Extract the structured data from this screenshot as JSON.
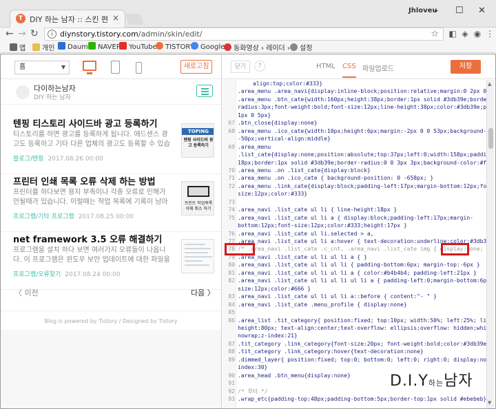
{
  "browser": {
    "tab_title": "DIY 하는 남자 :: 스킨 편",
    "tab_close": "×",
    "user": "Jhloveu",
    "win_min": "–",
    "win_max": "☐",
    "win_close": "✕",
    "url_host": "diynstory.tistory.com",
    "url_path": "/admin/skin/edit/",
    "bookmarks": [
      "앱",
      "개인",
      "Daum",
      "NAVER",
      "YouTube",
      "TISTORY",
      "Google",
      "동화영상 › 레이더 ›",
      "설정"
    ]
  },
  "preview": {
    "select_value": "홈",
    "refresh_label": "새로고침",
    "blog_title": "다이하는남자",
    "blog_sub": "DIY 하는 남자",
    "posts": [
      {
        "title": "텐핑 티스토리 사이드바 광고 등록하기",
        "excerpt": "티스토리를 하면 광고를 등록하게 됩니다. 애드센스 광고도 등록하고 기타 다른 업체의 광고도 등록할 수 있습니...",
        "category": "블로그/텐핑",
        "date": "2017.08.26 00:00",
        "thumb_top": "TOPING",
        "thumb_text": "텐핑 사이드바 광고 등록하기"
      },
      {
        "title": "프린터 인쇄 목록 오류 삭제 하는 방법",
        "excerpt": "프린터를 하다보면 용지 부족이나 각종 오류로 인해가 안될때가 있습니다. 이럴때는 작업 목록에 기록이 남아있어...",
        "category": "프로그램/기타 프로그램",
        "date": "2017.08.25 00:00",
        "thumb_text": "프린트 작업목록 삭제 취소 하기"
      },
      {
        "title": "net framework 3.5 오류 해결하기",
        "excerpt": "프로그램을 설치 하다 보면 여러가지 오류들이 나옵니다. 이 프로그램은 윈도우 보안 업데이트에 대한 파일을 입...",
        "category": "프로그램/오류찾기",
        "date": "2017.08.24 00:00"
      }
    ],
    "prev_label": "〈 이전",
    "next_label": "다음 〉",
    "powered": "Blog is powered by Tistory / Designed by Tistory"
  },
  "code_editor": {
    "cancel_label": "닫기",
    "help_label": "?",
    "tabs": [
      "HTML",
      "CSS",
      "파일업로드"
    ],
    "active_tab": "CSS",
    "save_label": "저장",
    "lines": [
      {
        "n": "",
        "t": "align:top;color:#333}",
        "cls": "wrap"
      },
      {
        "n": "",
        "t": ".area_menu .area_navi{display:inline-block;position:relative;margin:0 2px 0 3px}",
        "cls": ""
      },
      {
        "n": "",
        "t": ".area_menu .btn_cate{width:160px;height:38px;border:1px solid #3db39e;border-",
        "cls": ""
      },
      {
        "n": "",
        "t": "radius:3px;font-weight:bold;font-size:12px;line-height:38px;color:#3db39e;padding:0",
        "cls": ""
      },
      {
        "n": "",
        "t": "1px 0 5px}",
        "cls": ""
      },
      {
        "n": "67",
        "t": ".btn_close{display:none}",
        "cls": ""
      },
      {
        "n": "68",
        "t": ".area_menu .ico_cate{width:10px;height:6px;margin:-2px 0 0 53px;background-position:0",
        "cls": ""
      },
      {
        "n": "",
        "t": "-50px;vertical-align:middle}",
        "cls": ""
      },
      {
        "n": "69",
        "t": ".area_menu",
        "cls": ""
      },
      {
        "n": "",
        "t": ".list_cate{display:none;position:absolute;top:37px;left:0;width:158px;padding:18px 0",
        "cls": ""
      },
      {
        "n": "",
        "t": "18px;border:1px solid #3db39e;border-radius:0 0 3px 3px;background-color:#fff}",
        "cls": ""
      },
      {
        "n": "70",
        "t": ".area_menu .on .list_cate{display:block}",
        "cls": ""
      },
      {
        "n": "71",
        "t": ".area_menu .on .ico_cate { background-position: 0 -658px; }",
        "cls": ""
      },
      {
        "n": "72",
        "t": ".area_menu .link_cate{display:block;padding-left:17px;margin-bottom:12px;font-",
        "cls": ""
      },
      {
        "n": "",
        "t": "size:12px;color:#333}",
        "cls": ""
      },
      {
        "n": "73",
        "t": "",
        "cls": ""
      },
      {
        "n": "74",
        "t": ".area_navi .list_cate ul li { line-height:18px }",
        "cls": ""
      },
      {
        "n": "75",
        "t": ".area_navi .list_cate ul li a { display:block;padding-left:17px;margin-",
        "cls": ""
      },
      {
        "n": "",
        "t": "bottom:12px;font-size:12px;color:#333;height:17px }",
        "cls": ""
      },
      {
        "n": "76",
        "t": ".area_navi .list_cate ul li.selected > a,",
        "cls": ""
      },
      {
        "n": "77",
        "t": ".area_navi .list_cate ul li a:hover { text-decoration:underline;color:#3db39e }",
        "cls": ""
      },
      {
        "n": "78",
        "t": "/* .area_navi .list_cate .c_cnt, .area_navi .list_cate img { display:none; } */",
        "cls": "comment"
      },
      {
        "n": "79",
        "t": ".area_navi .list_cate ul li ul li a { }",
        "cls": ""
      },
      {
        "n": "80",
        "t": ".area_navi .list_cate ul li ul li { padding-bottom:6px; margin-top:-6px }",
        "cls": ""
      },
      {
        "n": "81",
        "t": ".area_navi .list_cate ul li ul li a { color:#b4b4b4; padding-left:21px }",
        "cls": ""
      },
      {
        "n": "82",
        "t": ".area_navi .list_cate ul li ul li ul li a { padding-left:0;margin-bottom:6px;font-",
        "cls": ""
      },
      {
        "n": "",
        "t": "size:12px;color:#666 }",
        "cls": ""
      },
      {
        "n": "83",
        "t": ".area_navi .list_cate ul li ul li a::before { content:\"- \" }",
        "cls": ""
      },
      {
        "n": "84",
        "t": ".area_navi .list_cate .menu_profile { display:none}",
        "cls": ""
      },
      {
        "n": "85",
        "t": "",
        "cls": ""
      },
      {
        "n": "86",
        "t": ".area_list .tit_category{ position:fixed; top:10px; width:50%; left:25%; line-",
        "cls": ""
      },
      {
        "n": "",
        "t": "height:80px; text-align:center;text-overflow: ellipsis;overflow: hidden;white-space:",
        "cls": ""
      },
      {
        "n": "",
        "t": "nowrap;z-index:21}",
        "cls": ""
      },
      {
        "n": "87",
        "t": ".tit_category .link_category{font-size:20px; font-weight:bold;color:#3db39e}",
        "cls": ""
      },
      {
        "n": "88",
        "t": ".tit_category .link_category:hover{text-decoration:none}",
        "cls": ""
      },
      {
        "n": "89",
        "t": ".dimmed_layer{ position:fixed; top:0; bottom:0; left:0; right:0; display:none; z-",
        "cls": ""
      },
      {
        "n": "",
        "t": "index:30}",
        "cls": ""
      },
      {
        "n": "90",
        "t": ".area_head .btn_menu{display:none}",
        "cls": ""
      },
      {
        "n": "91",
        "t": "",
        "cls": ""
      },
      {
        "n": "92",
        "t": "/* 푸터 */",
        "cls": "comment"
      },
      {
        "n": "93",
        "t": ".wrap_etc{padding-top:48px;padding-bottom:5px;border-top:1px solid #ebebeb}",
        "cls": ""
      }
    ]
  },
  "watermark": {
    "main": "D.I.Y",
    "small": "하는",
    "tail": "남자"
  }
}
